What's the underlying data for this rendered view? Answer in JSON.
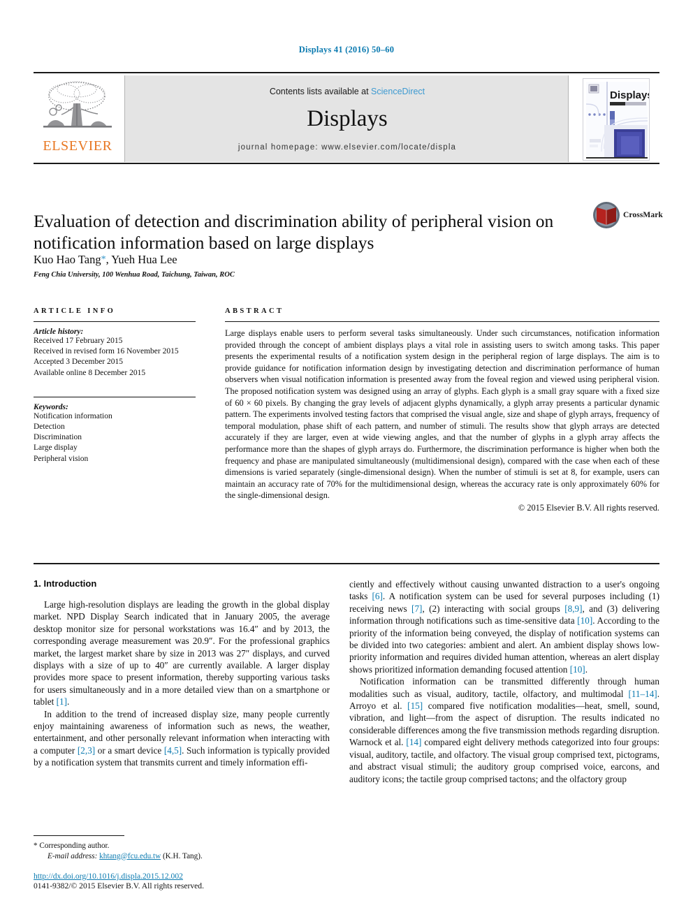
{
  "running_head": "Displays 41 (2016) 50–60",
  "masthead": {
    "publisher_name": "ELSEVIER",
    "publisher_logo": "elsevier-tree-logo",
    "contents_prefix": "Contents lists available at ",
    "contents_link": "ScienceDirect",
    "journal_name": "Displays",
    "homepage": "journal homepage: www.elsevier.com/locate/displa",
    "cover_title": "Displays"
  },
  "article": {
    "title": "Evaluation of detection and discrimination ability of peripheral vision on notification information based on large displays",
    "authors": "Kuo Hao Tang",
    "corresponding_marker": "*",
    "authors_rest": ", Yueh Hua Lee",
    "affiliation": "Feng Chia University, 100 Wenhua Road, Taichung, Taiwan, ROC",
    "crossmark_label": "CrossMark"
  },
  "article_info": {
    "heading": "Article info",
    "history_label": "Article history:",
    "history": [
      "Received 17 February 2015",
      "Received in revised form 16 November 2015",
      "Accepted 3 December 2015",
      "Available online 8 December 2015"
    ],
    "keywords_label": "Keywords:",
    "keywords": [
      "Notification information",
      "Detection",
      "Discrimination",
      "Large display",
      "Peripheral vision"
    ]
  },
  "abstract": {
    "heading": "Abstract",
    "text": "Large displays enable users to perform several tasks simultaneously. Under such circumstances, notification information provided through the concept of ambient displays plays a vital role in assisting users to switch among tasks. This paper presents the experimental results of a notification system design in the peripheral region of large displays. The aim is to provide guidance for notification information design by investigating detection and discrimination performance of human observers when visual notification information is presented away from the foveal region and viewed using peripheral vision. The proposed notification system was designed using an array of glyphs. Each glyph is a small gray square with a fixed size of 60 × 60 pixels. By changing the gray levels of adjacent glyphs dynamically, a glyph array presents a particular dynamic pattern. The experiments involved testing factors that comprised the visual angle, size and shape of glyph arrays, frequency of temporal modulation, phase shift of each pattern, and number of stimuli. The results show that glyph arrays are detected accurately if they are larger, even at wide viewing angles, and that the number of glyphs in a glyph array affects the performance more than the shapes of glyph arrays do. Furthermore, the discrimination performance is higher when both the frequency and phase are manipulated simultaneously (multidimensional design), compared with the case when each of these dimensions is varied separately (single-dimensional design). When the number of stimuli is set at 8, for example, users can maintain an accuracy rate of 70% for the multidimensional design, whereas the accuracy rate is only approximately 60% for the single-dimensional design.",
    "copyright": "© 2015 Elsevier B.V. All rights reserved."
  },
  "introduction": {
    "heading": "1. Introduction",
    "left_p1_a": "Large high-resolution displays are leading the growth in the global display market. NPD Display Search indicated that in January 2005, the average desktop monitor size for personal workstations was 16.4″ and by 2013, the corresponding average measurement was 20.9″. For the professional graphics market, the largest market share by size in 2013 was 27″ displays, and curved displays with a size of up to 40″ are currently available. A larger display provides more space to present information, thereby supporting various tasks for users simultaneously and in a more detailed view than on a smartphone or tablet ",
    "left_p1_ref": "[1]",
    "left_p1_b": ".",
    "left_p2_a": "In addition to the trend of increased display size, many people currently enjoy maintaining awareness of information such as news, the weather, entertainment, and other personally relevant information when interacting with a computer ",
    "left_p2_ref1": "[2,3]",
    "left_p2_b": " or a smart device ",
    "left_p2_ref2": "[4,5]",
    "left_p2_c": ". Such information is typically provided by a notification system that transmits current and timely information effi-",
    "right_p1_a": "ciently and effectively without causing unwanted distraction to a user's ongoing tasks ",
    "right_p1_ref1": "[6]",
    "right_p1_b": ". A notification system can be used for several purposes including (1) receiving news ",
    "right_p1_ref2": "[7]",
    "right_p1_c": ", (2) interacting with social groups ",
    "right_p1_ref3": "[8,9]",
    "right_p1_d": ", and (3) delivering information through notifications such as time-sensitive data ",
    "right_p1_ref4": "[10]",
    "right_p1_e": ". According to the priority of the information being conveyed, the display of notification systems can be divided into two categories: ambient and alert. An ambient display shows low-priority information and requires divided human attention, whereas an alert display shows prioritized information demanding focused attention ",
    "right_p1_ref5": "[10]",
    "right_p1_f": ".",
    "right_p2_a": "Notification information can be transmitted differently through human modalities such as visual, auditory, tactile, olfactory, and multimodal ",
    "right_p2_ref1": "[11–14]",
    "right_p2_b": ". Arroyo et al. ",
    "right_p2_ref2": "[15]",
    "right_p2_c": " compared five notification modalities—heat, smell, sound, vibration, and light—from the aspect of disruption. The results indicated no considerable differences among the five transmission methods regarding disruption. Warnock et al. ",
    "right_p2_ref3": "[14]",
    "right_p2_d": " compared eight delivery methods categorized into four groups: visual, auditory, tactile, and olfactory. The visual group comprised text, pictograms, and abstract visual stimuli; the auditory group comprised voice, earcons, and auditory icons; the tactile group comprised tactons; and the olfactory group"
  },
  "footer": {
    "corresponding_marker": "*",
    "corresponding_text": " Corresponding author.",
    "email_label": "E-mail address:",
    "email": "khtang@fcu.edu.tw",
    "email_suffix": " (K.H. Tang).",
    "doi": "http://dx.doi.org/10.1016/j.displa.2015.12.002",
    "issn_copyright": "0141-9382/© 2015 Elsevier B.V. All rights reserved."
  },
  "colors": {
    "link": "#0b7ab0",
    "elsevier_orange": "#e87722",
    "sciencedirect_blue": "#3d9ad1",
    "crossmark_red": "#b5231f"
  }
}
